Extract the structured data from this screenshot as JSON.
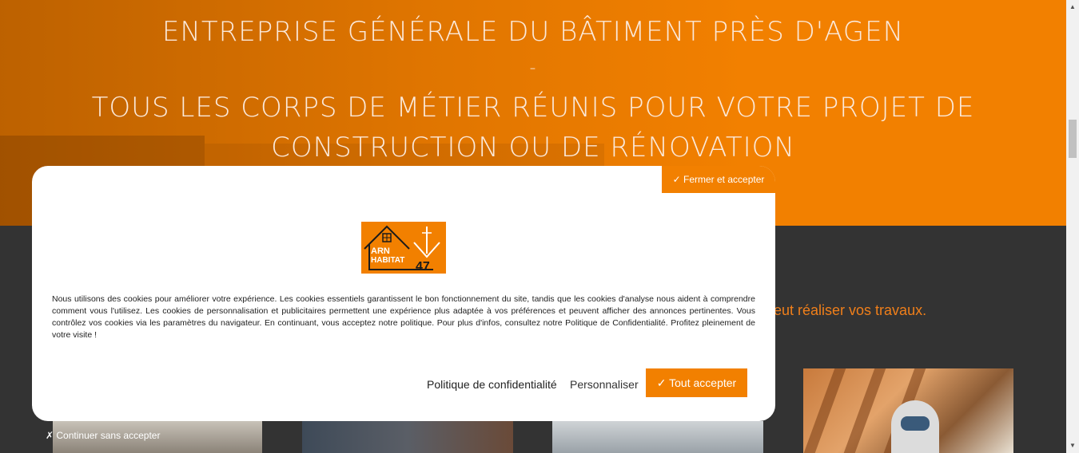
{
  "hero": {
    "line1": "ENTREPRISE GÉNÉRALE DU BÂTIMENT PRÈS D'AGEN",
    "dash": "-",
    "line2a": "TOUS LES CORPS DE MÉTIER RÉUNIS POUR VOTRE PROJET DE",
    "line2b": "CONSTRUCTION OU DE RÉNOVATION"
  },
  "section": {
    "subtitle_fragment": "eut réaliser vos travaux."
  },
  "cookie_banner": {
    "close_accept_label": "✓ Fermer et accepter",
    "logo": {
      "text_arn": "ARN",
      "text_habitat": "HABITAT",
      "text_47": "47"
    },
    "message": "Nous utilisons des cookies pour améliorer votre expérience. Les cookies essentiels garantissent le bon fonctionnement du site, tandis que les cookies d'analyse nous aident à comprendre comment vous l'utilisez. Les cookies de personnalisation et publicitaires permettent une expérience plus adaptée à vos préférences et peuvent afficher des annonces pertinentes. Vous contrôlez vos cookies via les paramètres du navigateur. En continuant, vous acceptez notre politique. Pour plus d'infos, consultez notre Politique de Confidentialité. Profitez pleinement de votre visite !",
    "privacy_link": "Politique de confidentialité",
    "customize_link": "Personnaliser",
    "accept_all_label": "✓ Tout accepter",
    "continue_label": "✗ Continuer sans accepter"
  },
  "scrollbar": {
    "up_icon": "▲",
    "down_icon": "▼"
  },
  "colors": {
    "brand_orange": "#f28000",
    "dark_bg": "#333333"
  }
}
